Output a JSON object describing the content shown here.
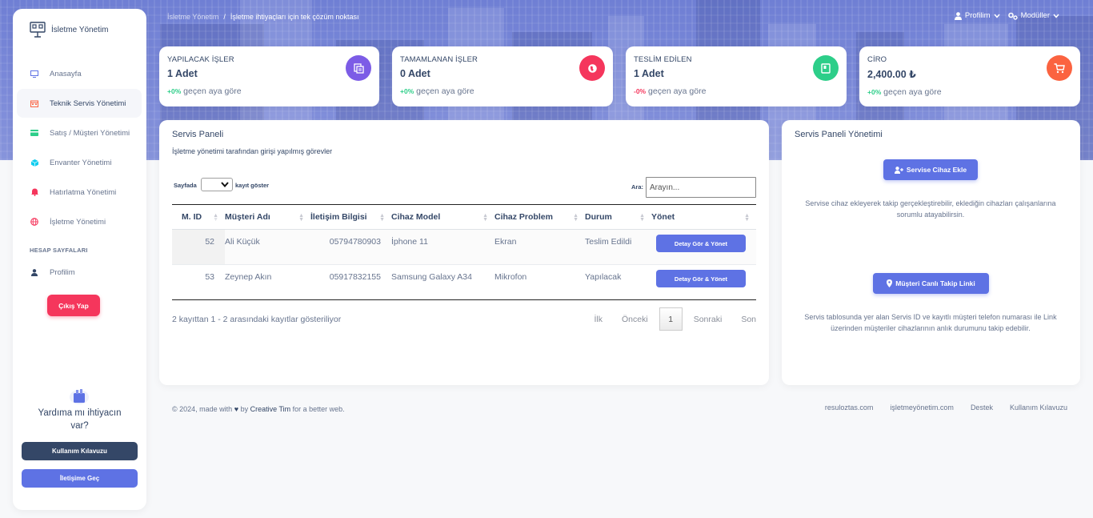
{
  "app": {
    "brand": "İsletme Yönetim"
  },
  "breadcrumb": {
    "parent": "İsletme Yönetim",
    "separator": "/",
    "current": "İşletme ihtiyaçları için tek çözüm noktası"
  },
  "topnav": {
    "profile": "Profilim",
    "modules": "Modüller"
  },
  "sidebar": {
    "items": [
      {
        "label": "Anasayfa",
        "icon": "monitor-icon",
        "color": "#5e72e4"
      },
      {
        "label": "Teknik Servis Yönetimi",
        "icon": "calendar-icon",
        "color": "#fb6340"
      },
      {
        "label": "Satış / Müşteri Yönetimi",
        "icon": "credit-card-icon",
        "color": "#2dce89"
      },
      {
        "label": "Envanter Yönetimi",
        "icon": "box-icon",
        "color": "#11cdef"
      },
      {
        "label": "Hatırlatma Yönetimi",
        "icon": "bell-icon",
        "color": "#f5365c"
      },
      {
        "label": "İşletme Yönetimi",
        "icon": "globe-icon",
        "color": "#f5365c"
      }
    ],
    "section_title": "HESAP SAYFALARI",
    "profile_label": "Profilim",
    "logout_label": "Çıkış Yap",
    "help_title": "Yardıma mı ihtiyacın var?",
    "guide_button": "Kullanım Kılavuzu",
    "contact_button": "İletişime Geç"
  },
  "stats": [
    {
      "label": "YAPILACAK İŞLER",
      "value": "1 Adet",
      "change": "+0%",
      "change_type": "positive",
      "suffix": "geçen aya göre",
      "icon": "document-icon",
      "color": "#7c5ce6"
    },
    {
      "label": "TAMAMLANAN İŞLER",
      "value": "0 Adet",
      "change": "+0%",
      "change_type": "positive",
      "suffix": "geçen aya göre",
      "icon": "globe-icon",
      "color": "#f5365c"
    },
    {
      "label": "TESLİM EDİLEN",
      "value": "1 Adet",
      "change": "-0%",
      "change_type": "negative",
      "suffix": "geçen aya göre",
      "icon": "book-icon",
      "color": "#2dce89"
    },
    {
      "label": "CİRO",
      "value": "2,400.00 ₺",
      "change": "+0%",
      "change_type": "positive",
      "suffix": "geçen aya göre",
      "icon": "cart-icon",
      "color": "#fb6340"
    }
  ],
  "service_panel": {
    "title": "Servis Paneli",
    "subtitle": "İşletme yönetimi tarafından girişi yapılmış görevler",
    "length_prefix": "Sayfada",
    "length_suffix": "kayıt göster",
    "search_label": "Ara:",
    "search_placeholder": "Arayın...",
    "columns": [
      "M. ID",
      "Müşteri Adı",
      "İletişim Bilgisi",
      "Cihaz Model",
      "Cihaz Problem",
      "Durum",
      "Yönet"
    ],
    "rows": [
      {
        "id": "52",
        "name": "Ali Küçük",
        "phone": "05794780903",
        "model": "İphone 11",
        "problem": "Ekran",
        "status": "Teslim Edildi",
        "action": "Detay Gör & Yönet"
      },
      {
        "id": "53",
        "name": "Zeynep Akın",
        "phone": "05917832155",
        "model": "Samsung Galaxy A34",
        "problem": "Mikrofon",
        "status": "Yapılacak",
        "action": "Detay Gör & Yönet"
      }
    ],
    "info": "2 kayıttan 1 - 2 arasındaki kayıtlar gösteriliyor",
    "pager": {
      "first": "İlk",
      "prev": "Önceki",
      "current": "1",
      "next": "Sonraki",
      "last": "Son"
    }
  },
  "management_panel": {
    "title": "Servis Paneli Yönetimi",
    "add_button": "Servise Cihaz Ekle",
    "add_text": "Servise cihaz ekleyerek takip gerçekleştirebilir, eklediğin cihazları çalışanlarına sorumlu atayabilirsin.",
    "tracking_button": "Müşteri Canlı Takip Linki",
    "tracking_text": "Servis tablosunda yer alan Servis ID ve kayıtlı müşteri telefon numarası ile Link üzerinden müşteriler cihazlarının anlık durumunu takip edebilir."
  },
  "footer": {
    "copyright_prefix": "© 2024, made with",
    "by": "by",
    "author": "Creative Tim",
    "copyright_suffix": "for a better web.",
    "links": [
      "resuloztas.com",
      "işletmeyönetim.com",
      "Destek",
      "Kullanım Kılavuzu"
    ]
  }
}
